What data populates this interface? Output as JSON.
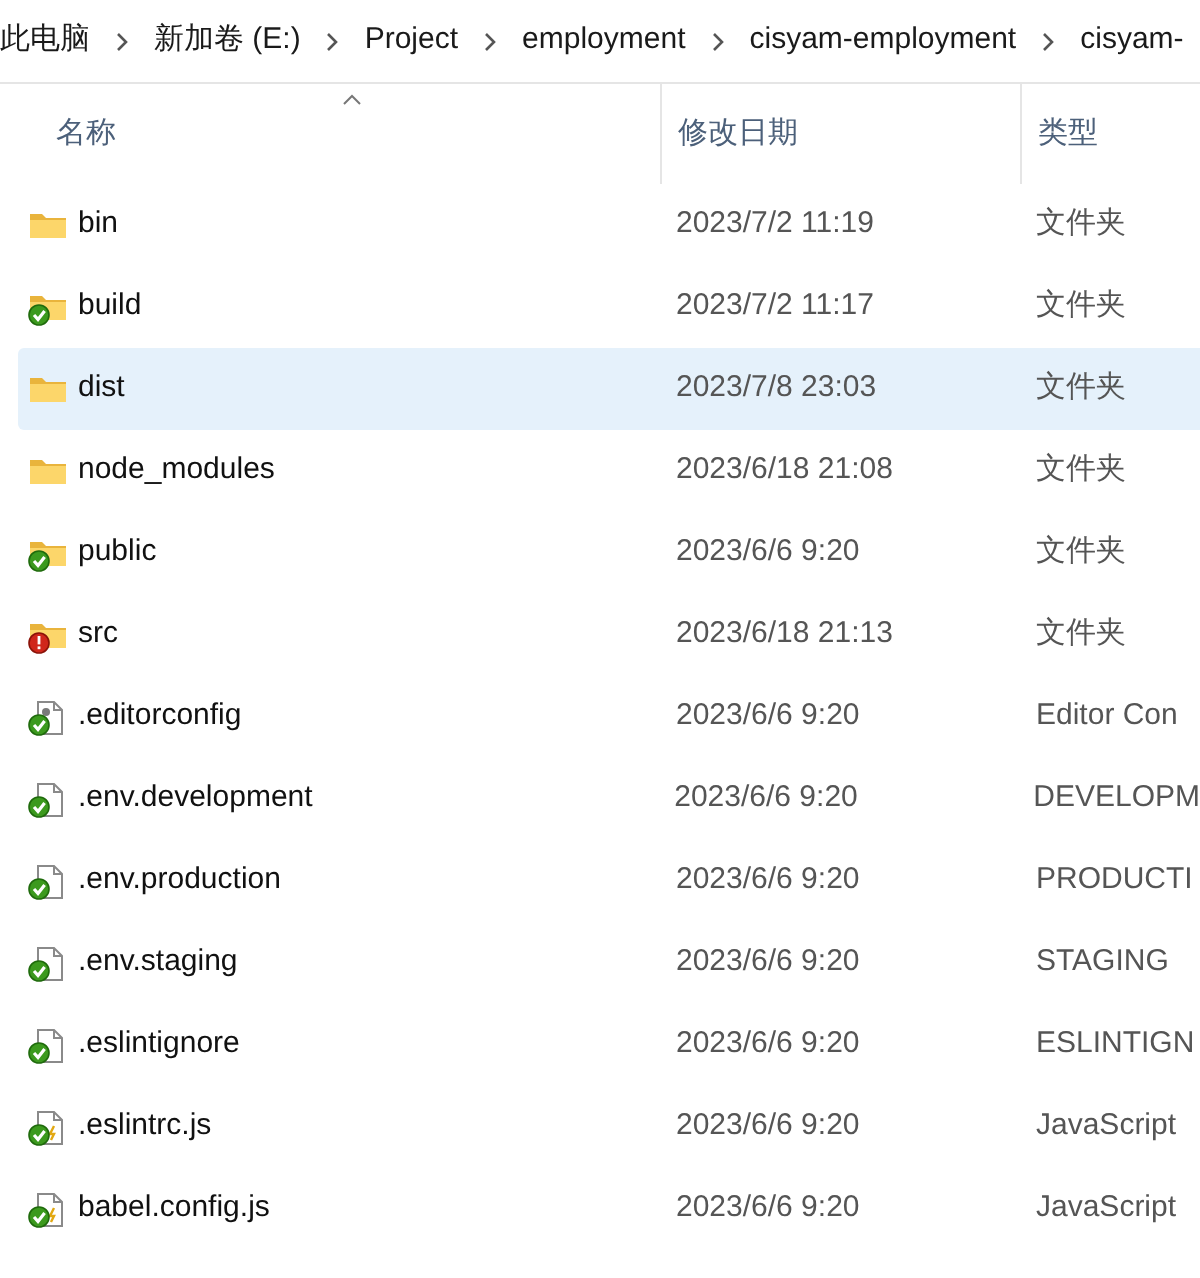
{
  "breadcrumb": [
    "此电脑",
    "新加卷 (E:)",
    "Project",
    "employment",
    "cisyam-employment",
    "cisyam-"
  ],
  "columns": [
    {
      "label": "名称",
      "sorted": true
    },
    {
      "label": "修改日期",
      "sorted": false
    },
    {
      "label": "类型",
      "sorted": false
    }
  ],
  "rows": [
    {
      "name": "bin",
      "kind": "folder",
      "synced": false,
      "error": false,
      "modified": "2023/7/2 11:19",
      "type": "文件夹",
      "selected": false
    },
    {
      "name": "build",
      "kind": "folder",
      "synced": true,
      "error": false,
      "modified": "2023/7/2 11:17",
      "type": "文件夹",
      "selected": false
    },
    {
      "name": "dist",
      "kind": "folder",
      "synced": false,
      "error": false,
      "modified": "2023/7/8 23:03",
      "type": "文件夹",
      "selected": true
    },
    {
      "name": "node_modules",
      "kind": "folder",
      "synced": false,
      "error": false,
      "modified": "2023/6/18 21:08",
      "type": "文件夹",
      "selected": false
    },
    {
      "name": "public",
      "kind": "folder",
      "synced": true,
      "error": false,
      "modified": "2023/6/6 9:20",
      "type": "文件夹",
      "selected": false
    },
    {
      "name": "src",
      "kind": "folder",
      "synced": false,
      "error": true,
      "modified": "2023/6/18 21:13",
      "type": "文件夹",
      "selected": false
    },
    {
      "name": ".editorconfig",
      "kind": "config",
      "synced": true,
      "error": false,
      "modified": "2023/6/6 9:20",
      "type": "Editor Con",
      "selected": false
    },
    {
      "name": ".env.development",
      "kind": "file",
      "synced": true,
      "error": false,
      "modified": "2023/6/6 9:20",
      "type": "DEVELOPM",
      "selected": false
    },
    {
      "name": ".env.production",
      "kind": "file",
      "synced": true,
      "error": false,
      "modified": "2023/6/6 9:20",
      "type": "PRODUCTI",
      "selected": false
    },
    {
      "name": ".env.staging",
      "kind": "file",
      "synced": true,
      "error": false,
      "modified": "2023/6/6 9:20",
      "type": "STAGING",
      "selected": false
    },
    {
      "name": ".eslintignore",
      "kind": "file",
      "synced": true,
      "error": false,
      "modified": "2023/6/6 9:20",
      "type": "ESLINTIGN",
      "selected": false
    },
    {
      "name": ".eslintrc.js",
      "kind": "script",
      "synced": true,
      "error": false,
      "modified": "2023/6/6 9:20",
      "type": "JavaScript",
      "selected": false
    },
    {
      "name": "babel.config.js",
      "kind": "script",
      "synced": true,
      "error": false,
      "modified": "2023/6/6 9:20",
      "type": "JavaScript",
      "selected": false
    }
  ]
}
